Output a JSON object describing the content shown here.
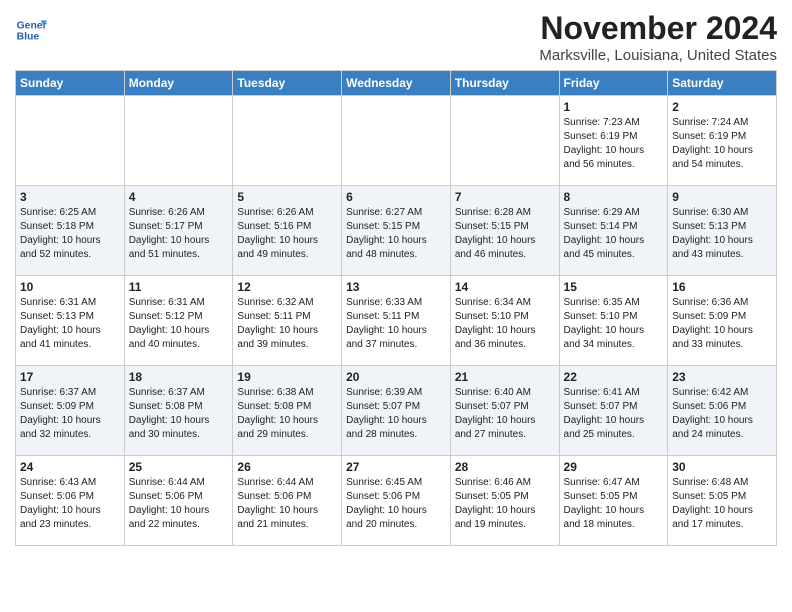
{
  "header": {
    "logo_line1": "General",
    "logo_line2": "Blue",
    "title": "November 2024",
    "subtitle": "Marksville, Louisiana, United States"
  },
  "days_of_week": [
    "Sunday",
    "Monday",
    "Tuesday",
    "Wednesday",
    "Thursday",
    "Friday",
    "Saturday"
  ],
  "weeks": [
    {
      "cells": [
        {
          "day": "",
          "info": ""
        },
        {
          "day": "",
          "info": ""
        },
        {
          "day": "",
          "info": ""
        },
        {
          "day": "",
          "info": ""
        },
        {
          "day": "",
          "info": ""
        },
        {
          "day": "1",
          "info": "Sunrise: 7:23 AM\nSunset: 6:19 PM\nDaylight: 10 hours\nand 56 minutes."
        },
        {
          "day": "2",
          "info": "Sunrise: 7:24 AM\nSunset: 6:19 PM\nDaylight: 10 hours\nand 54 minutes."
        }
      ]
    },
    {
      "cells": [
        {
          "day": "3",
          "info": "Sunrise: 6:25 AM\nSunset: 5:18 PM\nDaylight: 10 hours\nand 52 minutes."
        },
        {
          "day": "4",
          "info": "Sunrise: 6:26 AM\nSunset: 5:17 PM\nDaylight: 10 hours\nand 51 minutes."
        },
        {
          "day": "5",
          "info": "Sunrise: 6:26 AM\nSunset: 5:16 PM\nDaylight: 10 hours\nand 49 minutes."
        },
        {
          "day": "6",
          "info": "Sunrise: 6:27 AM\nSunset: 5:15 PM\nDaylight: 10 hours\nand 48 minutes."
        },
        {
          "day": "7",
          "info": "Sunrise: 6:28 AM\nSunset: 5:15 PM\nDaylight: 10 hours\nand 46 minutes."
        },
        {
          "day": "8",
          "info": "Sunrise: 6:29 AM\nSunset: 5:14 PM\nDaylight: 10 hours\nand 45 minutes."
        },
        {
          "day": "9",
          "info": "Sunrise: 6:30 AM\nSunset: 5:13 PM\nDaylight: 10 hours\nand 43 minutes."
        }
      ]
    },
    {
      "cells": [
        {
          "day": "10",
          "info": "Sunrise: 6:31 AM\nSunset: 5:13 PM\nDaylight: 10 hours\nand 41 minutes."
        },
        {
          "day": "11",
          "info": "Sunrise: 6:31 AM\nSunset: 5:12 PM\nDaylight: 10 hours\nand 40 minutes."
        },
        {
          "day": "12",
          "info": "Sunrise: 6:32 AM\nSunset: 5:11 PM\nDaylight: 10 hours\nand 39 minutes."
        },
        {
          "day": "13",
          "info": "Sunrise: 6:33 AM\nSunset: 5:11 PM\nDaylight: 10 hours\nand 37 minutes."
        },
        {
          "day": "14",
          "info": "Sunrise: 6:34 AM\nSunset: 5:10 PM\nDaylight: 10 hours\nand 36 minutes."
        },
        {
          "day": "15",
          "info": "Sunrise: 6:35 AM\nSunset: 5:10 PM\nDaylight: 10 hours\nand 34 minutes."
        },
        {
          "day": "16",
          "info": "Sunrise: 6:36 AM\nSunset: 5:09 PM\nDaylight: 10 hours\nand 33 minutes."
        }
      ]
    },
    {
      "cells": [
        {
          "day": "17",
          "info": "Sunrise: 6:37 AM\nSunset: 5:09 PM\nDaylight: 10 hours\nand 32 minutes."
        },
        {
          "day": "18",
          "info": "Sunrise: 6:37 AM\nSunset: 5:08 PM\nDaylight: 10 hours\nand 30 minutes."
        },
        {
          "day": "19",
          "info": "Sunrise: 6:38 AM\nSunset: 5:08 PM\nDaylight: 10 hours\nand 29 minutes."
        },
        {
          "day": "20",
          "info": "Sunrise: 6:39 AM\nSunset: 5:07 PM\nDaylight: 10 hours\nand 28 minutes."
        },
        {
          "day": "21",
          "info": "Sunrise: 6:40 AM\nSunset: 5:07 PM\nDaylight: 10 hours\nand 27 minutes."
        },
        {
          "day": "22",
          "info": "Sunrise: 6:41 AM\nSunset: 5:07 PM\nDaylight: 10 hours\nand 25 minutes."
        },
        {
          "day": "23",
          "info": "Sunrise: 6:42 AM\nSunset: 5:06 PM\nDaylight: 10 hours\nand 24 minutes."
        }
      ]
    },
    {
      "cells": [
        {
          "day": "24",
          "info": "Sunrise: 6:43 AM\nSunset: 5:06 PM\nDaylight: 10 hours\nand 23 minutes."
        },
        {
          "day": "25",
          "info": "Sunrise: 6:44 AM\nSunset: 5:06 PM\nDaylight: 10 hours\nand 22 minutes."
        },
        {
          "day": "26",
          "info": "Sunrise: 6:44 AM\nSunset: 5:06 PM\nDaylight: 10 hours\nand 21 minutes."
        },
        {
          "day": "27",
          "info": "Sunrise: 6:45 AM\nSunset: 5:06 PM\nDaylight: 10 hours\nand 20 minutes."
        },
        {
          "day": "28",
          "info": "Sunrise: 6:46 AM\nSunset: 5:05 PM\nDaylight: 10 hours\nand 19 minutes."
        },
        {
          "day": "29",
          "info": "Sunrise: 6:47 AM\nSunset: 5:05 PM\nDaylight: 10 hours\nand 18 minutes."
        },
        {
          "day": "30",
          "info": "Sunrise: 6:48 AM\nSunset: 5:05 PM\nDaylight: 10 hours\nand 17 minutes."
        }
      ]
    }
  ]
}
